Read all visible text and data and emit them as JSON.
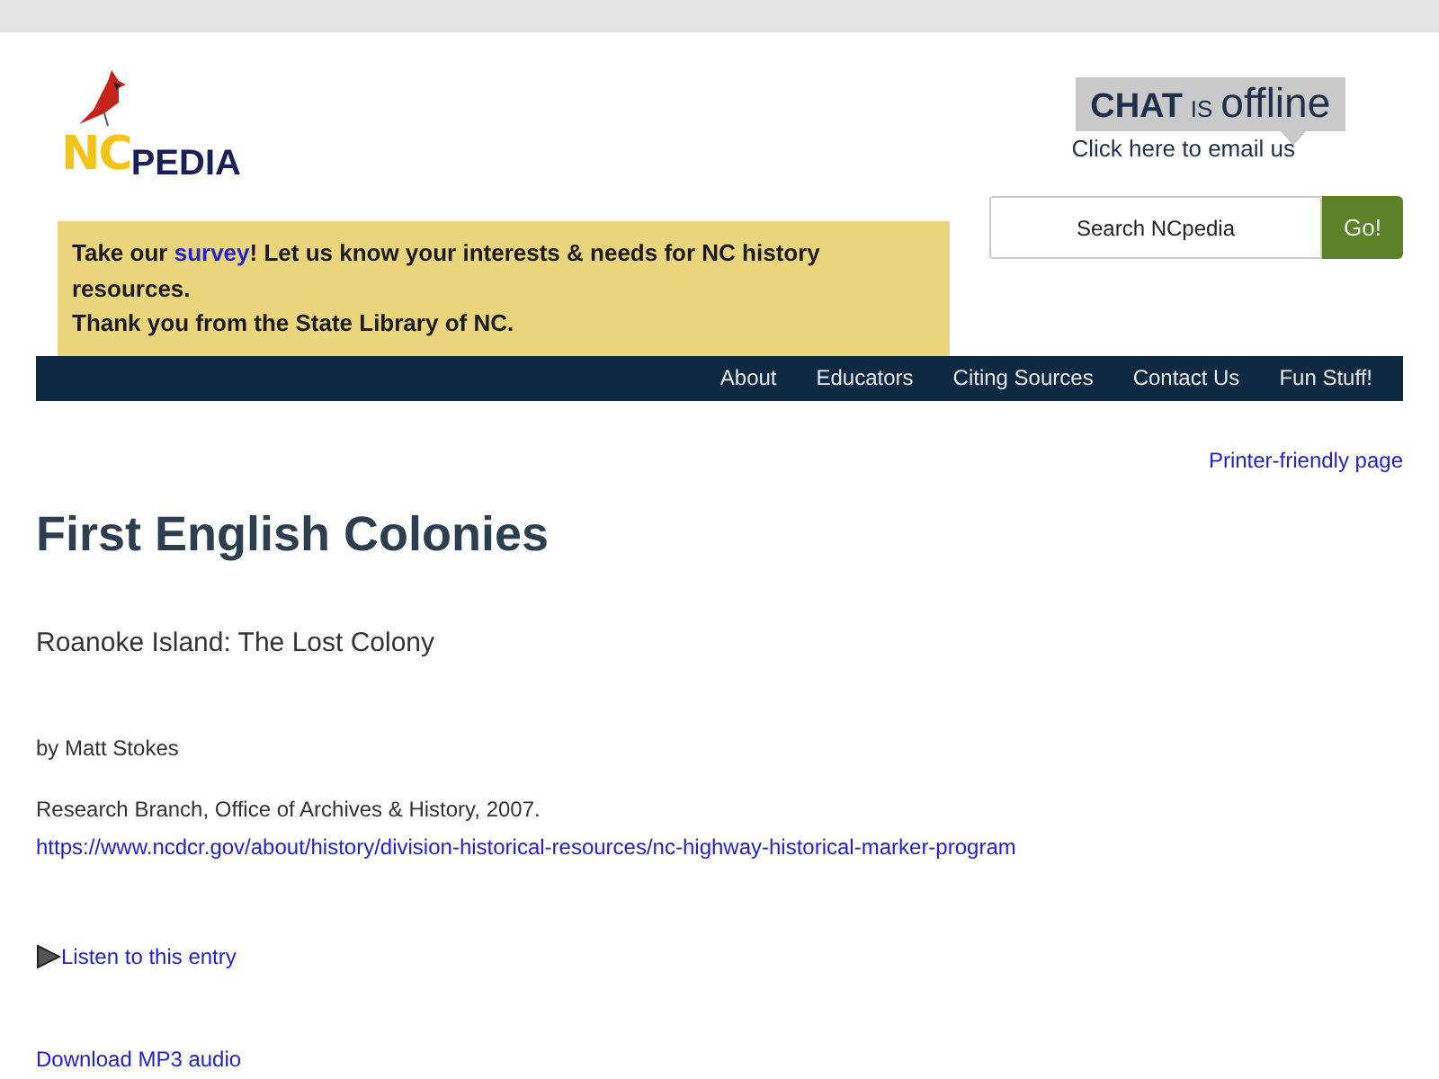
{
  "logo": {
    "first": "NC",
    "second": "PEDIA"
  },
  "chat": {
    "label": "CHAT",
    "connector": "IS",
    "status": "offline",
    "link": "Click here to email us"
  },
  "banner": {
    "before": "Take our ",
    "link": "survey",
    "after": "! Let us know your interests & needs for NC history resources.",
    "line_2": "Thank you from the State Library of NC."
  },
  "search": {
    "placeholder": "Search NCpedia",
    "button": "Go!"
  },
  "nav": [
    "About",
    "Educators",
    "Citing Sources",
    "Contact Us",
    "Fun Stuff!"
  ],
  "printer_link": "Printer-friendly page",
  "title": "First English Colonies",
  "subtitle": "Roanoke Island: The Lost Colony",
  "byline": "by Matt Stokes",
  "source": "Research Branch, Office of Archives & History, 2007.",
  "source_url": "https://www.ncdcr.gov/about/history/division-historical-resources/nc-highway-historical-marker-program",
  "listen_link": "Listen to this entry",
  "download_link": "Download MP3 audio"
}
